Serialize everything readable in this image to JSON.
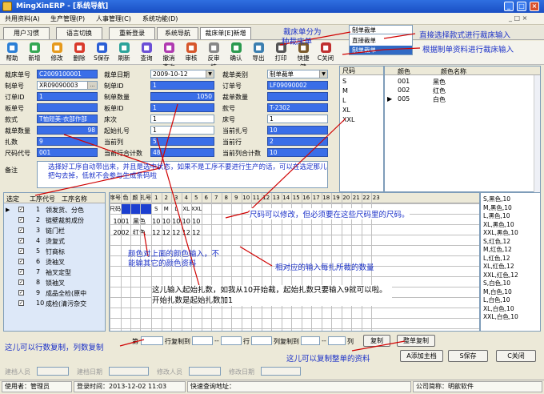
{
  "window": {
    "title": "MingXinERP - [系统导航]"
  },
  "menu": [
    "共用资料(A)",
    "生产管理(P)",
    "人事管理(C)",
    "系统功能(D)"
  ],
  "tabs": [
    "用户习惯",
    "语言切换",
    "重新登录",
    "系统导航",
    "裁床单[E]新增"
  ],
  "toolbar": [
    "帮助",
    "新增",
    "修改",
    "删除",
    "S保存",
    "刷新",
    "查询",
    "撤消查询",
    "审核",
    "反审核",
    "确认",
    "导出",
    "打印",
    "快捷键",
    "C关闭"
  ],
  "form": {
    "labels": {
      "cut_no": "裁床单号",
      "cut_date": "裁单日期",
      "cut_type": "裁单类别",
      "order_no": "制单号",
      "order_id": "制单ID",
      "order_id2": "订单号",
      "order_id_lbl": "订单ID",
      "order_qty": "制单数量",
      "board_no": "板单号",
      "board_id": "板单ID",
      "cut_qty": "裁单数量",
      "style_no": "款号",
      "style": "款式",
      "bed_no": "床次",
      "bed_qty": "床号",
      "cut_bundle_qty": "裁单数量",
      "start_bundle": "起始扎号",
      "cur_bundle": "当前扎号",
      "bundles": "扎数",
      "cur_col": "当前列",
      "cur_row": "当前行",
      "size_code": "尺码代号",
      "cur_row_total": "当前行合计数",
      "cur_col_total": "当前列合计数",
      "remark": "备注"
    },
    "values": {
      "cut_no": "C2009100001",
      "cut_date": "2009-10-12",
      "cut_type": "制单裁单",
      "order_no": "XR09090003",
      "order_id": "1",
      "order_id2": "LF09090002",
      "order_id_val": "1",
      "order_qty": "1050",
      "board_id": "1",
      "style_no": "T-2302",
      "style": "T恤短美-衣部作部",
      "bed_no": "1",
      "bed_qty": "1",
      "cut_bundle_qty": "98",
      "start_bundle": "1",
      "cur_bundle": "10",
      "bundles": "9",
      "cur_col": "5",
      "cur_row": "2",
      "size_code": "001",
      "cur_row_total": "48",
      "cur_col_total": "10"
    }
  },
  "cut_type_dropdown": {
    "selected": "制单裁单",
    "options": [
      "直接裁单",
      "制单裁单"
    ]
  },
  "size_panel": {
    "header": "尺码",
    "sizes": [
      "S",
      "M",
      "L",
      "XL",
      "XXL"
    ]
  },
  "color_panel": {
    "headers": [
      "颜色",
      "颜色名称"
    ],
    "rows": [
      [
        "001",
        "黑色"
      ],
      [
        "002",
        "红色"
      ],
      [
        "005",
        "白色"
      ]
    ]
  },
  "process_table": {
    "headers": [
      "选定",
      "工序代号",
      "工序名称"
    ],
    "rows": [
      [
        "1",
        "领发货、分色"
      ],
      [
        "2",
        "链壁裁剪成份"
      ],
      [
        "3",
        "链门栏"
      ],
      [
        "4",
        "烫复式"
      ],
      [
        "5",
        "钉商标"
      ],
      [
        "6",
        "烫袖叉"
      ],
      [
        "7",
        "袖叉定型"
      ],
      [
        "8",
        "锁袖叉"
      ],
      [
        "9",
        "成品全检(原中"
      ],
      [
        "10",
        "成检(清污杂交"
      ]
    ]
  },
  "bundle_grid": {
    "headers": [
      "序号",
      "色号",
      "颜色",
      "扎号",
      "1",
      "2",
      "3",
      "4",
      "5",
      "6",
      "7",
      "8",
      "9",
      "10",
      "11",
      "12",
      "13",
      "14",
      "15",
      "16",
      "17",
      "18",
      "19",
      "20",
      "21",
      "22",
      "23"
    ],
    "size_row": [
      "尺码",
      "S",
      "M",
      "L",
      "XL",
      "XXL"
    ],
    "rows": [
      {
        "seq": "1",
        "code": "001",
        "color": "黑色",
        "values": [
          "10",
          "10",
          "10",
          "10",
          "10"
        ]
      },
      {
        "seq": "2",
        "code": "002",
        "color": "红色",
        "values": [
          "12",
          "12",
          "12",
          "12",
          "12"
        ]
      }
    ]
  },
  "summary_list": [
    "S,黑色,10",
    "M,黑色,10",
    "L,黑色,10",
    "XL,黑色,10",
    "XXL,黑色,10",
    "S,红色,12",
    "M,红色,12",
    "L,红色,12",
    "XL,红色,12",
    "XXL,红色,12",
    "S,白色,10",
    "M,白色,10",
    "L,白色,10",
    "XL,白色,10",
    "XXL,白色,10"
  ],
  "annotations": {
    "a1": "裁床单分为",
    "a2": "种裁床单",
    "a3": "直接选择款式进行裁床输入",
    "a4": "根据制单资料进行裁床输入",
    "a5": "选择好工序自动带出来，并且是选中状态，如果不是工序不要进行生产的话，可以在选定那儿把勾去掉，低就不会参与生成条码啦",
    "a6": "尺码可以修改，但必须要在这些尺码里的尺码。",
    "a7": "颜色对上面的颜色输入，不能输其它的颜色资料",
    "a8": "相对应的输入每扎所裁的数量",
    "a9": "这儿输入起始扎数，如我从10开始裁，起始扎数只要输入9就可以啦。开始扎数是起始扎数加1",
    "a10": "这儿可以行数复制，列数复制",
    "a11": "这儿可以复制整单的资料"
  },
  "copy_bar": {
    "di": "第",
    "row_copy": "行复制到",
    "col_copy": "列复制到",
    "row": "行",
    "col": "列",
    "copy": "复制",
    "whole_copy": "整单复制"
  },
  "buttons": {
    "add": "A添加主档",
    "save": "S保存",
    "close": "C关闭"
  },
  "audit": [
    "建档人员",
    "建档日期",
    "修改人员",
    "修改日期"
  ],
  "status": {
    "user_lbl": "使用者：管理员",
    "login": "登录时间：2013-12-02 11:03",
    "quick": "快速查询地址：",
    "company": "公司简称：明歆软件"
  },
  "colors": {
    "title": "#1a4fc4",
    "highlight": "#3a6ee8",
    "annotation": "#1a30c8",
    "arrow": "#d00000"
  }
}
